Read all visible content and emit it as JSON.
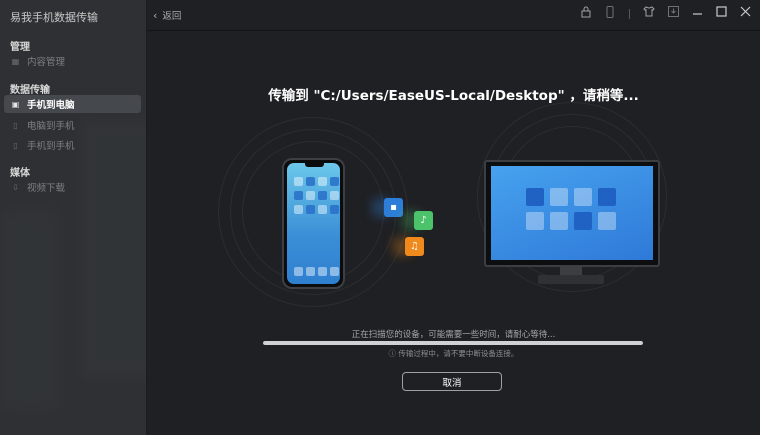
{
  "app": {
    "title": "易我手机数据传输"
  },
  "sidebar": {
    "sections": [
      {
        "label": "管理",
        "items": [
          {
            "label": "内容管理",
            "icon": "grid-icon",
            "active": false
          }
        ]
      },
      {
        "label": "数据传输",
        "items": [
          {
            "label": "手机到电脑",
            "icon": "phone-to-pc-icon",
            "active": true
          },
          {
            "label": "电脑到手机",
            "icon": "pc-to-phone-icon",
            "active": false
          },
          {
            "label": "手机到手机",
            "icon": "phone-to-phone-icon",
            "active": false
          }
        ]
      },
      {
        "label": "媒体",
        "items": [
          {
            "label": "视频下载",
            "icon": "download-icon",
            "active": false
          }
        ]
      }
    ]
  },
  "topbar": {
    "back_label": "返回",
    "icons": [
      "lock-icon",
      "phone-icon",
      "tshirt-icon",
      "download-box-icon",
      "minimize-icon",
      "maximize-icon",
      "close-icon"
    ]
  },
  "main": {
    "title": "传输到 \"C:/Users/EaseUS-Local/Desktop\" ，请稍等...",
    "status_text": "正在扫描您的设备，可能需要一些时间，请耐心等待...",
    "progress": 1.0,
    "note": "ⓘ 传输过程中，请不要中断设备连接。",
    "cancel_label": "取消"
  },
  "colors": {
    "accent": "#2f7fd0",
    "background": "#1f2023",
    "sidebar": "#2e3033"
  }
}
